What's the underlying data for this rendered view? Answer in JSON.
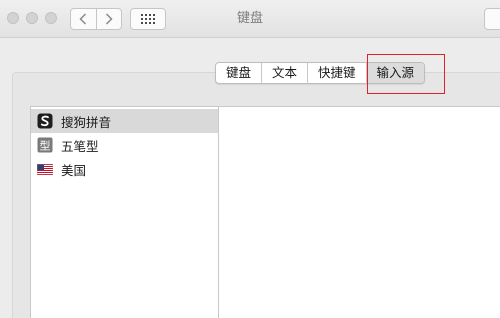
{
  "window": {
    "title": "键盘"
  },
  "tabs": [
    {
      "label": "键盘"
    },
    {
      "label": "文本"
    },
    {
      "label": "快捷键"
    },
    {
      "label": "输入源",
      "active": true
    }
  ],
  "input_sources": [
    {
      "label": "搜狗拼音",
      "icon": "sogou-s-icon",
      "selected": true
    },
    {
      "label": "五笔型",
      "icon": "wubi-xing-icon"
    },
    {
      "label": "美国",
      "icon": "us-flag-icon"
    }
  ],
  "colors": {
    "highlight": "#e0202a",
    "selected_row": "#d9d9d9",
    "window_bg": "#ececec"
  }
}
